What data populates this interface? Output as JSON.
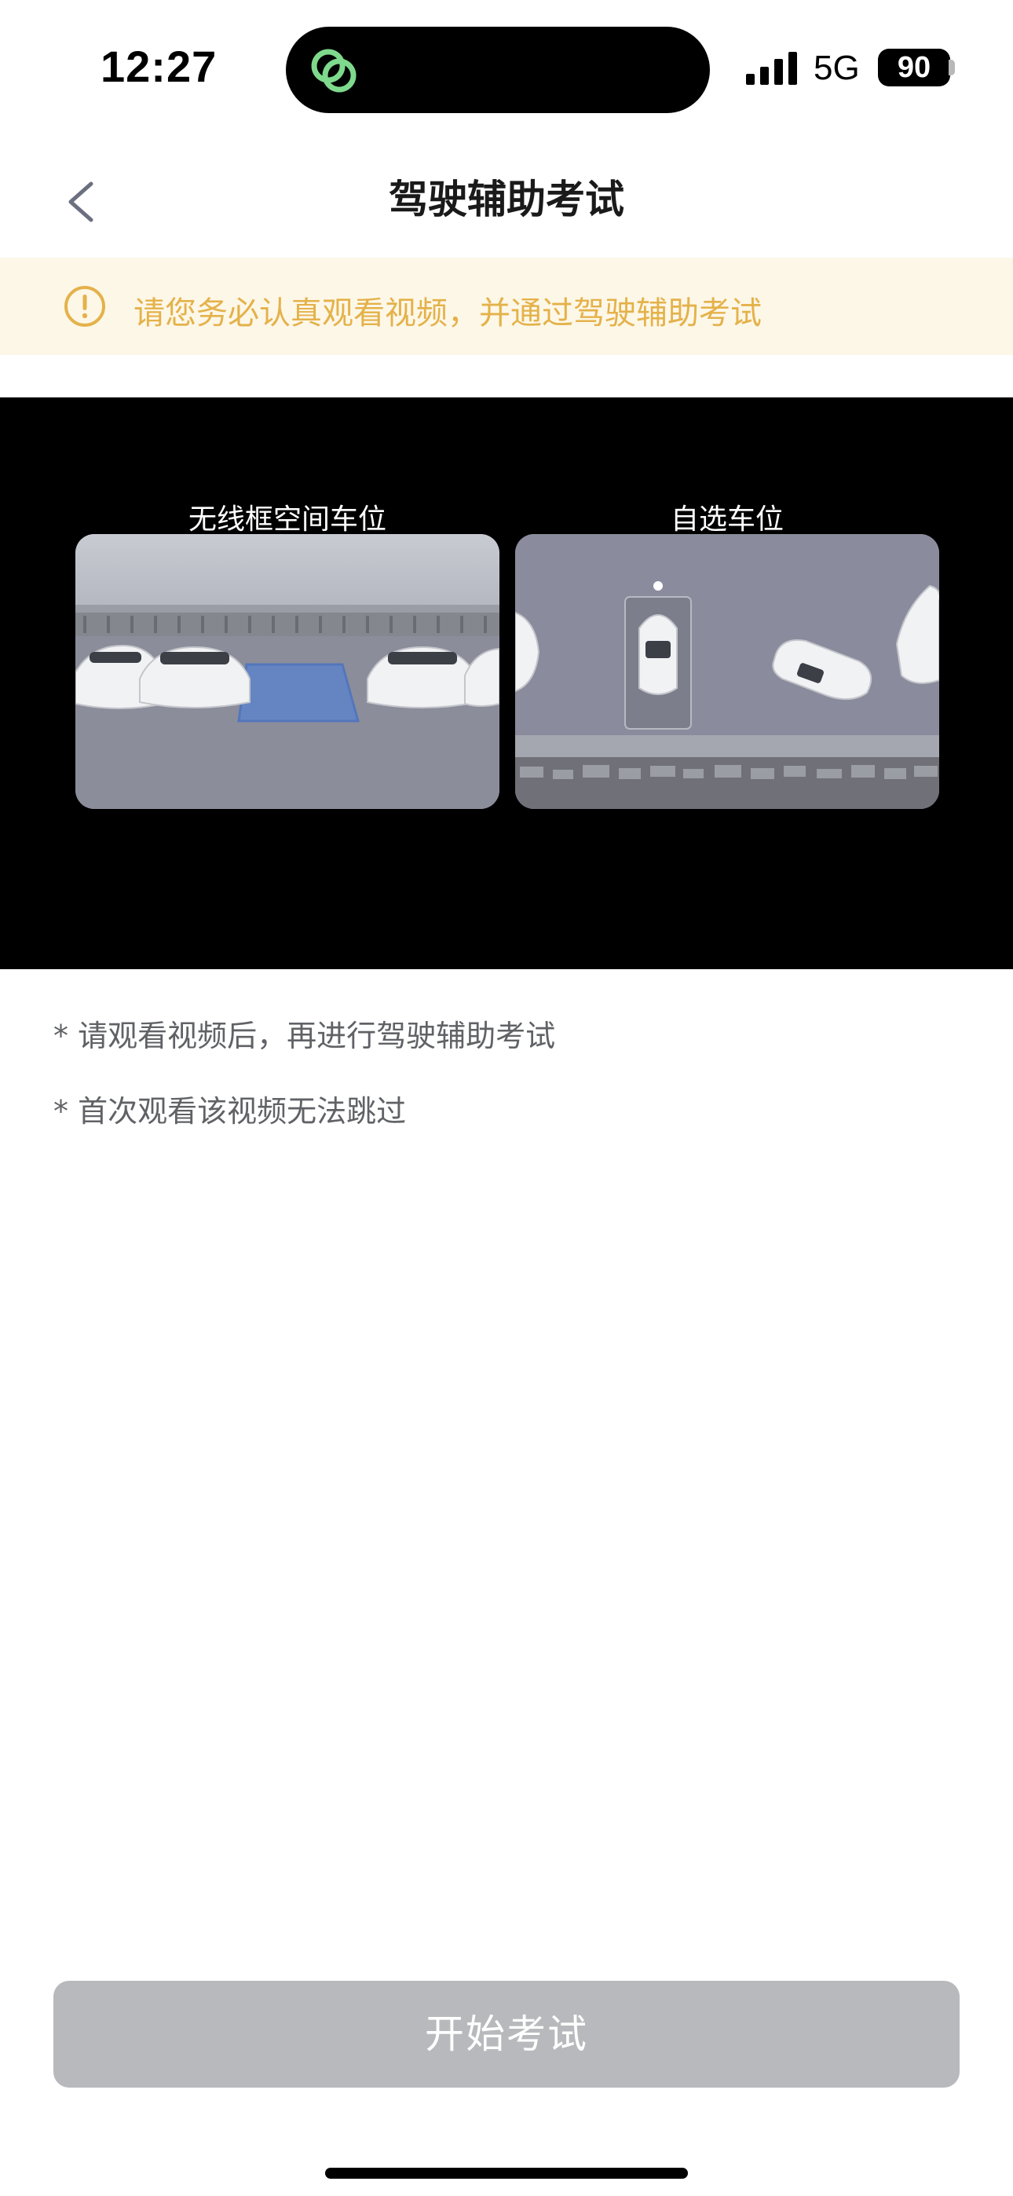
{
  "status_bar": {
    "time": "12:27",
    "network": "5G",
    "battery": "90",
    "app_icon": "link-rings-icon",
    "signal_icon": "cellular-signal-icon"
  },
  "nav": {
    "back_icon": "chevron-left-icon",
    "title": "驾驶辅助考试"
  },
  "notice": {
    "icon": "exclamation-circle-icon",
    "text": "请您务必认真观看视频，并通过驾驶辅助考试",
    "color": "#e4b24a",
    "background": "#fdf7e8"
  },
  "video": {
    "left_label": "无线框空间车位",
    "right_label": "自选车位"
  },
  "notes": [
    "* 请观看视频后，再进行驾驶辅助考试",
    "* 首次观看该视频无法跳过"
  ],
  "start_button": {
    "label": "开始考试",
    "state": "disabled",
    "color": "#b8b9bc"
  }
}
